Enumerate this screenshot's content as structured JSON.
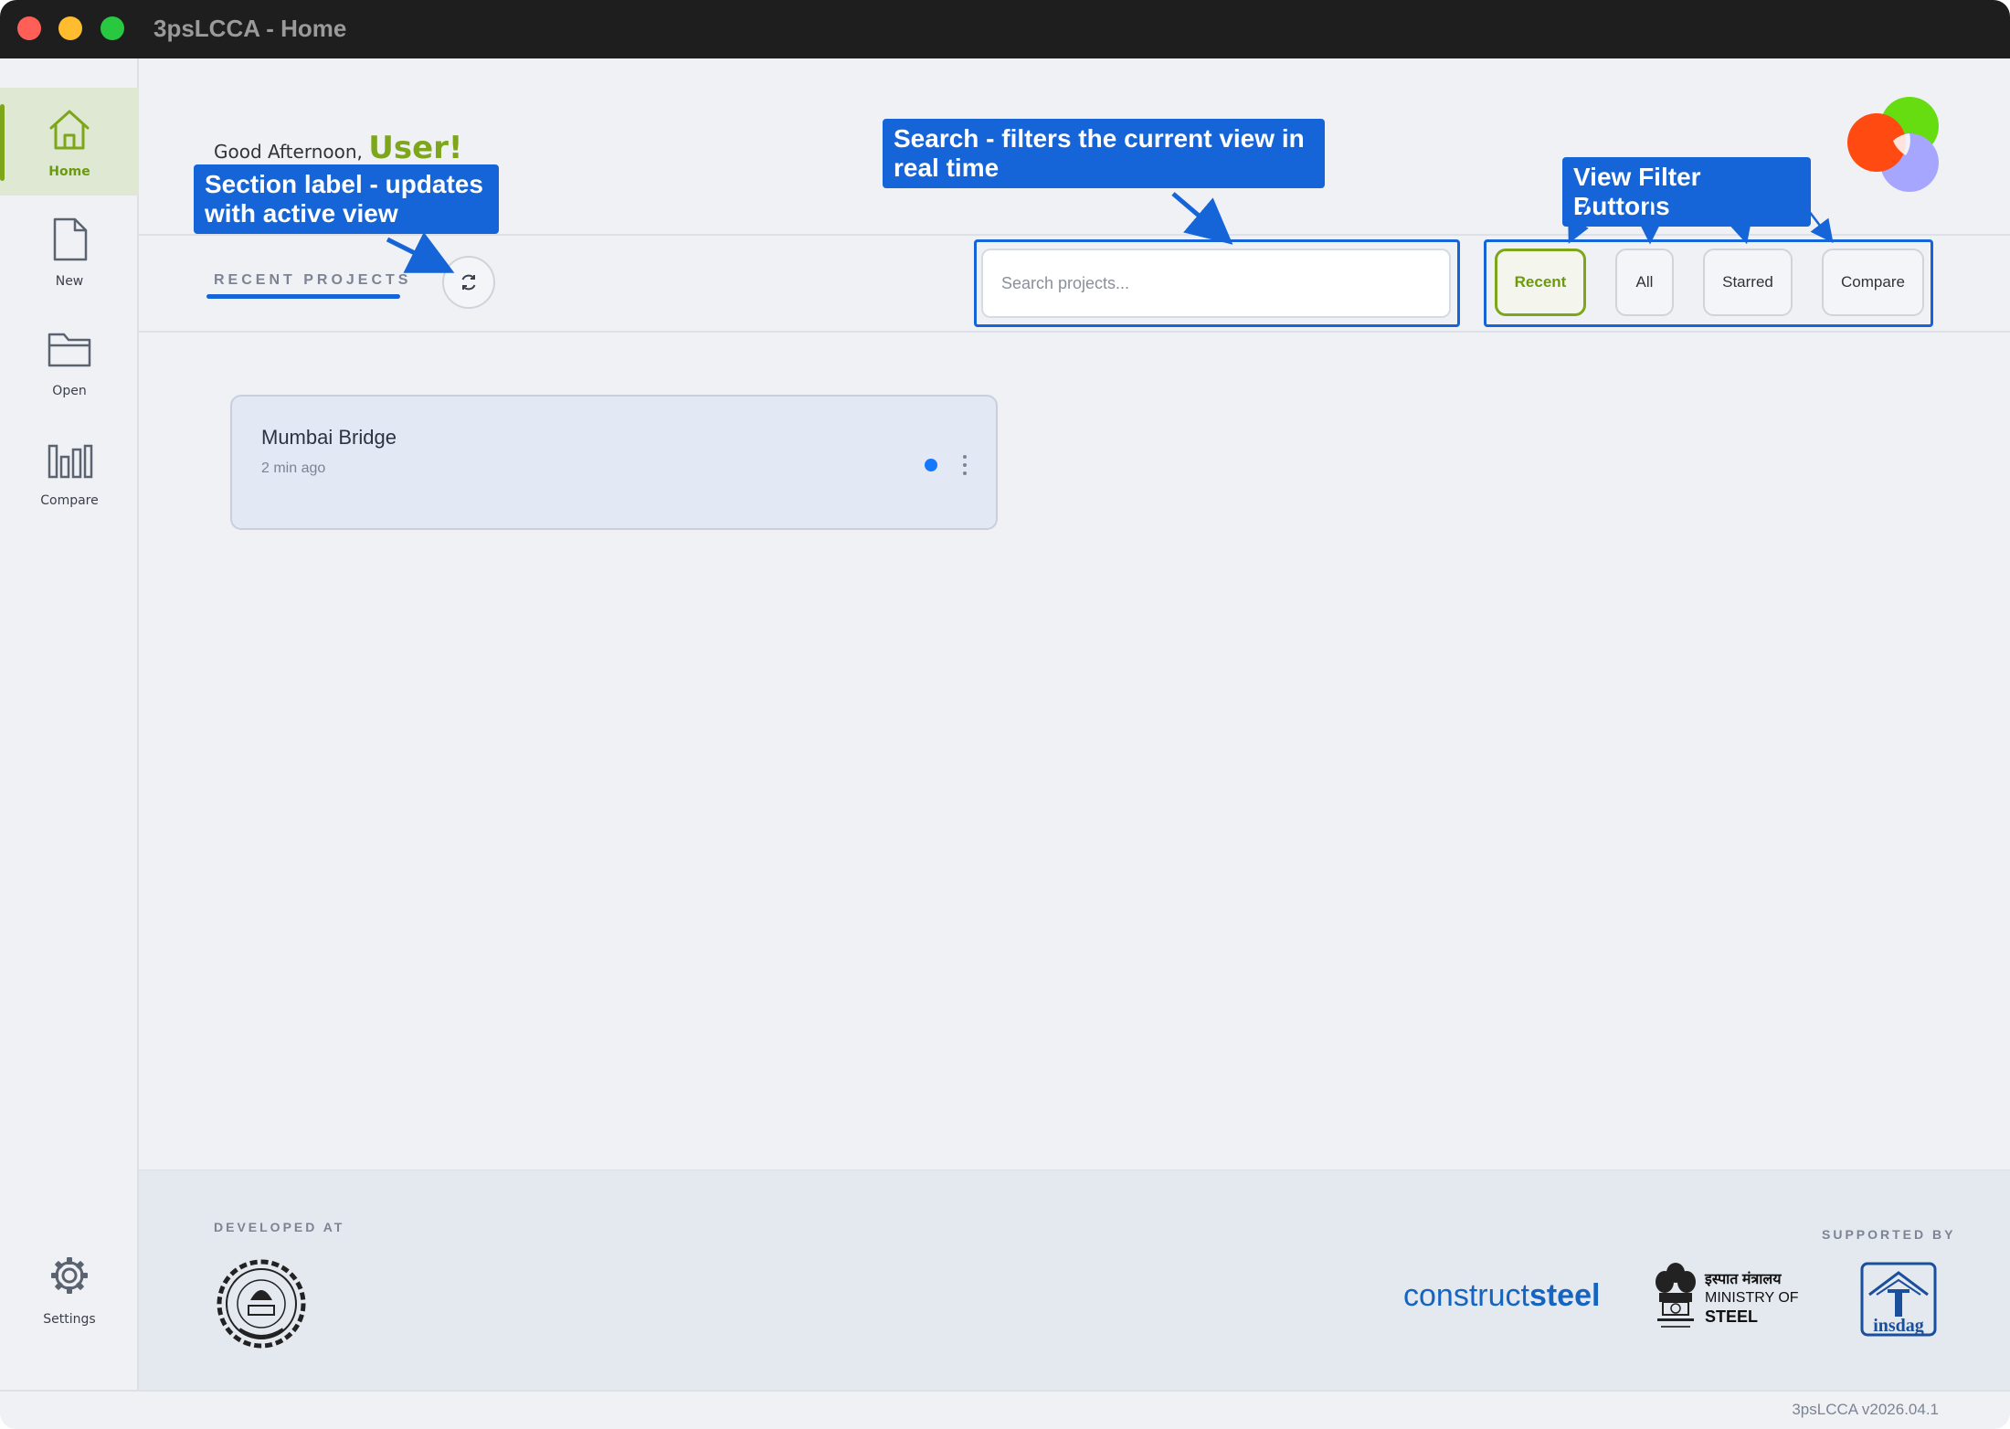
{
  "window": {
    "title": "3psLCCA - Home"
  },
  "sidebar": {
    "items": [
      {
        "label": "Home",
        "icon": "home-icon",
        "active": true
      },
      {
        "label": "New",
        "icon": "file-icon",
        "active": false
      },
      {
        "label": "Open",
        "icon": "folder-icon",
        "active": false
      },
      {
        "label": "Compare",
        "icon": "bar-chart-icon",
        "active": false
      }
    ],
    "settings": {
      "label": "Settings",
      "icon": "gear-icon"
    }
  },
  "header": {
    "greeting_prefix": "Good Afternoon,",
    "user_name": "User!"
  },
  "toolbar": {
    "section_label": "RECENT PROJECTS",
    "search_placeholder": "Search projects...",
    "filters": [
      {
        "label": "Recent",
        "active": true
      },
      {
        "label": "All",
        "active": false
      },
      {
        "label": "Starred",
        "active": false
      },
      {
        "label": "Compare",
        "active": false
      }
    ]
  },
  "projects": [
    {
      "name": "Mumbai Bridge",
      "time": "2 min ago",
      "status_color": "#1677ff"
    }
  ],
  "footer": {
    "developed_at": "DEVELOPED AT",
    "supported_by": "SUPPORTED BY",
    "constructsteel_light": "construct",
    "constructsteel_bold": "steel",
    "ministry_hindi": "इस्पात मंत्रालय",
    "ministry_line1": "MINISTRY OF",
    "ministry_line2": "STEEL",
    "insdag_text": "insdag"
  },
  "statusbar": {
    "version": "3psLCCA v2026.04.1"
  },
  "annotations": {
    "section_label_note": [
      "Section label - updates",
      "with active view"
    ],
    "search_note": [
      "Search - filters the current view in",
      "real time"
    ],
    "filters_note": "View Filter Buttons"
  },
  "colors": {
    "accent_green": "#7ea61a",
    "annotation_blue": "#1565d8",
    "titlebar": "#1e1e1e"
  }
}
